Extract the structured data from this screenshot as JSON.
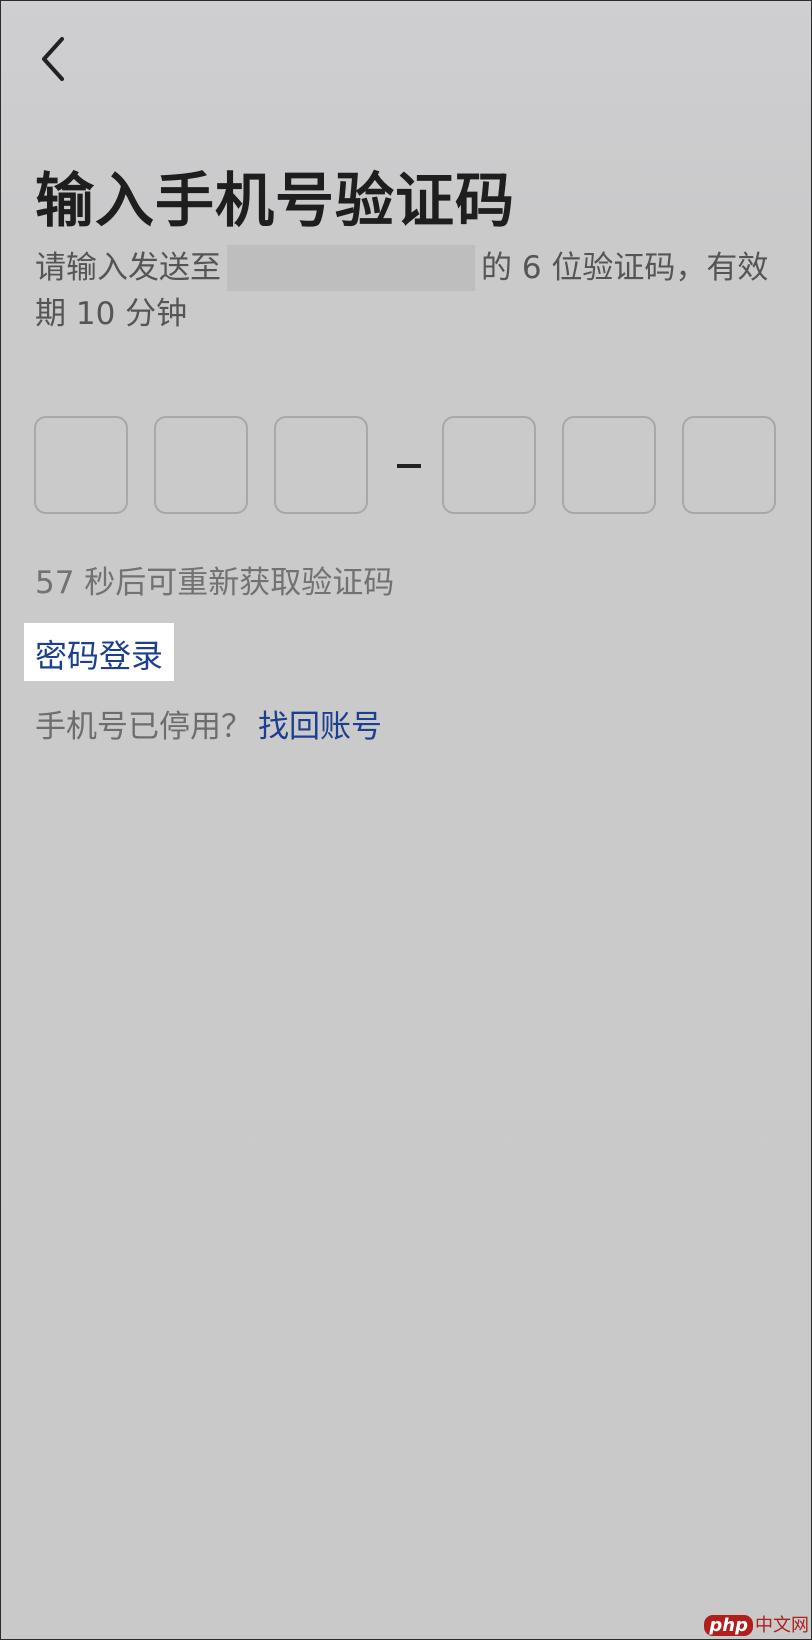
{
  "header": {
    "back_icon": "chevron-left-icon"
  },
  "title": "输入手机号验证码",
  "description": {
    "prefix": "请输入发送至",
    "suffix": "的 6 位验证码，有效期 10 分钟"
  },
  "code_input": {
    "digits": [
      "",
      "",
      "",
      "",
      "",
      ""
    ],
    "separator": "-"
  },
  "countdown": "57 秒后可重新获取验证码",
  "password_login": "密码登录",
  "recover": {
    "text": "手机号已停用？",
    "link": "找回账号"
  },
  "watermark": {
    "brand": "php",
    "suffix": "中文网"
  },
  "colors": {
    "link": "#1c3f8f",
    "title": "#1e1e1e",
    "background": "#c9c9c9"
  }
}
